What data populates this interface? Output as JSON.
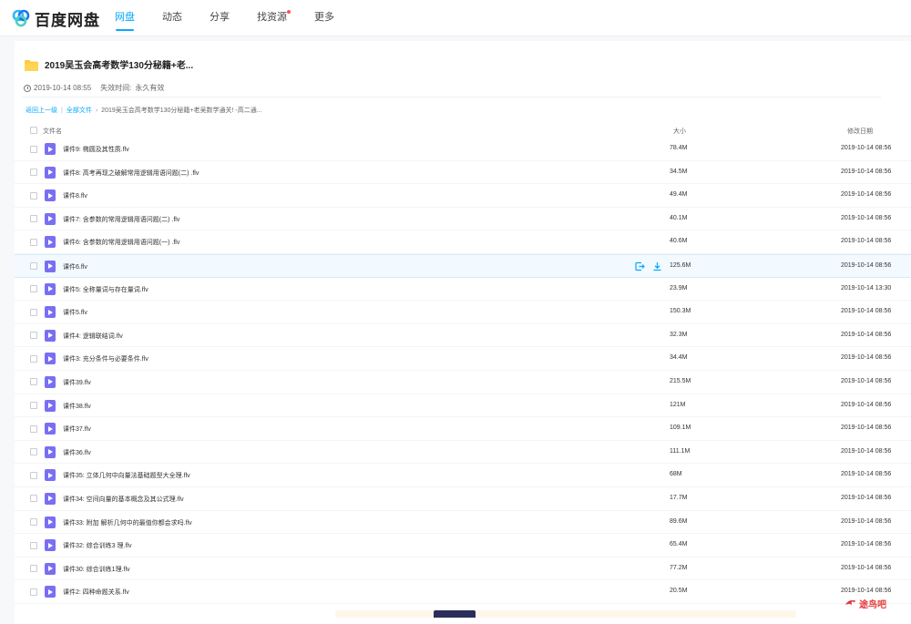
{
  "header": {
    "logo_text": "百度网盘",
    "nav": [
      {
        "label": "网盘",
        "active": true
      },
      {
        "label": "动态",
        "active": false
      },
      {
        "label": "分享",
        "active": false
      },
      {
        "label": "找资源",
        "active": false,
        "badge": true
      },
      {
        "label": "更多",
        "active": false
      }
    ]
  },
  "share": {
    "title": "2019吴玉会高考数学130分秘籍+老...",
    "created": "2019-10-14 08:55",
    "expire_label": "失效时间:",
    "expire_value": "永久有效"
  },
  "breadcrumb": {
    "back": "返回上一级",
    "all": "全部文件",
    "current": "2019吴玉会高考数学130分秘籍+老吴数学通关! -高二通..."
  },
  "table": {
    "col_name": "文件名",
    "col_size": "大小",
    "col_date": "修改日期",
    "rows": [
      {
        "name": "课件9:  椭圆及其性质.flv",
        "size": "78.4M",
        "date": "2019-10-14 08:56"
      },
      {
        "name": "课件8:  高考再现之破解常用逻辑用语问题(二) .flv",
        "size": "34.5M",
        "date": "2019-10-14 08:56"
      },
      {
        "name": "课件8.flv",
        "size": "49.4M",
        "date": "2019-10-14 08:56"
      },
      {
        "name": "课件7:  含参数的常用逻辑用语问题(二) .flv",
        "size": "40.1M",
        "date": "2019-10-14 08:56"
      },
      {
        "name": "课件6:  含参数的常用逻辑用语问题(一) .flv",
        "size": "40.6M",
        "date": "2019-10-14 08:56"
      },
      {
        "name": "课件6.flv",
        "size": "125.6M",
        "date": "2019-10-14 08:56"
      },
      {
        "name": "课件5:  全称量词与存在量词.flv",
        "size": "23.9M",
        "date": "2019-10-14 13:30"
      },
      {
        "name": "课件5.flv",
        "size": "150.3M",
        "date": "2019-10-14 08:56"
      },
      {
        "name": "课件4:  逻辑联结词.flv",
        "size": "32.3M",
        "date": "2019-10-14 08:56"
      },
      {
        "name": "课件3:  充分条件与必要条件.flv",
        "size": "34.4M",
        "date": "2019-10-14 08:56"
      },
      {
        "name": "课件39.flv",
        "size": "215.5M",
        "date": "2019-10-14 08:56"
      },
      {
        "name": "课件38.flv",
        "size": "121M",
        "date": "2019-10-14 08:56"
      },
      {
        "name": "课件37.flv",
        "size": "109.1M",
        "date": "2019-10-14 08:56"
      },
      {
        "name": "课件36.flv",
        "size": "111.1M",
        "date": "2019-10-14 08:56"
      },
      {
        "name": "课件35:  立体几何中向量法基础题型大全理.flv",
        "size": "68M",
        "date": "2019-10-14 08:56"
      },
      {
        "name": "课件34:  空间向量的基本概念及其公式理.flv",
        "size": "17.7M",
        "date": "2019-10-14 08:56"
      },
      {
        "name": "课件33:  附加 解析几何中的最值你都会求吗.flv",
        "size": "89.6M",
        "date": "2019-10-14 08:56"
      },
      {
        "name": "课件32:  综合训练3 理.flv",
        "size": "65.4M",
        "date": "2019-10-14 08:56"
      },
      {
        "name": "课件30:  综合训练1理.flv",
        "size": "77.2M",
        "date": "2019-10-14 08:56"
      },
      {
        "name": "课件2:  四种命题关系.flv",
        "size": "20.5M",
        "date": "2019-10-14 08:56"
      }
    ],
    "hover_row": 5
  },
  "watermark": {
    "text": "途鸟吧"
  },
  "colors": {
    "accent": "#06a7ff",
    "video_icon": "#7a6ef3",
    "folder": "#ffc93c"
  }
}
